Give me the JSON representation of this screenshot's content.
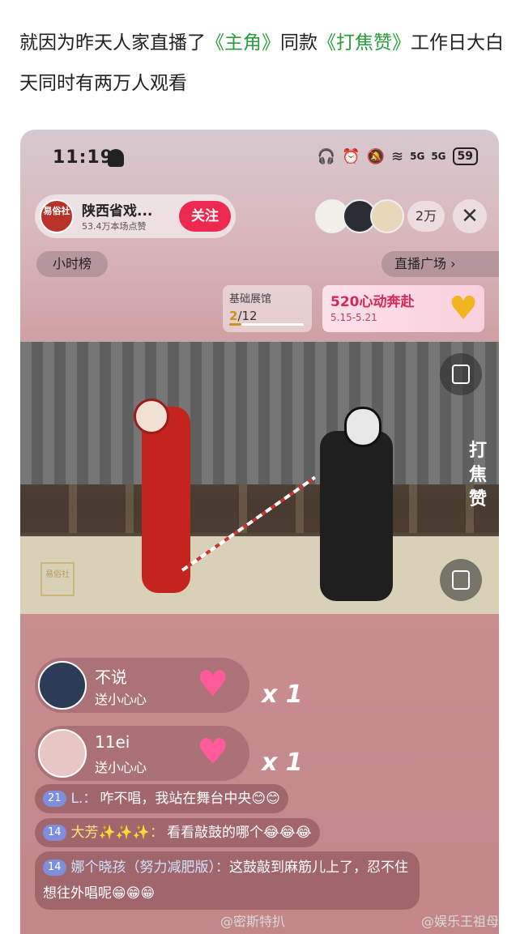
{
  "post": {
    "text_part1": "就因为昨天人家直播了",
    "highlight1": "《主角》",
    "text_part2": "同款",
    "highlight2": "《打焦赞》",
    "text_part3": "工作日大白天同时有两万人观看"
  },
  "status_bar": {
    "time": "11:19",
    "battery": "59",
    "signal_label": "5G"
  },
  "anchor": {
    "logo_text": "易俗社",
    "name": "陕西省戏...",
    "likes": "53.4万本场点赞",
    "follow_label": "关注"
  },
  "viewer_count": "2万",
  "close_label": "✕",
  "hour_rank_label": "小时榜",
  "plaza_label": "直播广场 ›",
  "exhibit": {
    "title": "基础展馆",
    "current": "2",
    "total": "/12",
    "progress": 0.1667
  },
  "event": {
    "title": "520心动奔赴",
    "date": "5.15-5.21"
  },
  "side_text": "打焦赞",
  "gifts": [
    {
      "name": "不说",
      "action": "送小心心",
      "count": "x 1",
      "avatar_color": "#2c3b56"
    },
    {
      "name": "11ei",
      "action": "送小心心",
      "count": "x 1",
      "avatar_color": "#e7c6c3"
    }
  ],
  "danmu": [
    {
      "level": "21",
      "user": "L.：",
      "text": "咋不唱，我站在舞台中央😊😊"
    },
    {
      "level": "14",
      "user": "大芳✨✨✨：",
      "text": "看看敲鼓的哪个😂😂😂"
    }
  ],
  "danmu_long": {
    "level": "14",
    "user": "娜个晓孩（努力减肥版）：",
    "text": "这鼓敲到麻筋儿上了，忍不住想往外唱呢😁😁😁"
  },
  "watermarks": {
    "left": "@密斯特扒",
    "right": "@娱乐王祖母"
  }
}
